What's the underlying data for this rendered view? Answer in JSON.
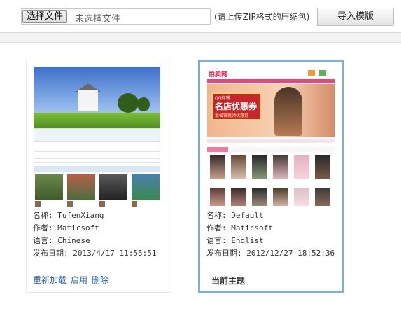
{
  "upload": {
    "choose_button": "选择文件",
    "file_status": "未选择文件",
    "hint": "(请上传ZIP格式的压缩包)",
    "import_button": "导入模版"
  },
  "themes": [
    {
      "name_label": "名称:",
      "name": "TufenXiang",
      "author_label": "作者:",
      "author": "Maticsoft",
      "language_label": "语言:",
      "language": "Chinese",
      "date_label": "发布日期:",
      "date": "2013/4/17 11:55:51",
      "actions": [
        "重新加载",
        "启用",
        "删除"
      ]
    },
    {
      "name_label": "名称:",
      "name": "Default",
      "author_label": "作者:",
      "author": "Maticsoft",
      "language_label": "语言:",
      "language": "Englist",
      "date_label": "发布日期:",
      "date": "2012/12/27 18:52:36",
      "status": "当前主题"
    }
  ],
  "thumb2": {
    "logo": "拍卖网",
    "coupon_top": "QQ商城",
    "coupon_main": "名店优惠券",
    "coupon_sub": "爱省钱就领优惠券"
  },
  "colors": {
    "selected_border": "#7eaedd",
    "link": "#1f5ea8",
    "accent_pink": "#e8457a"
  }
}
